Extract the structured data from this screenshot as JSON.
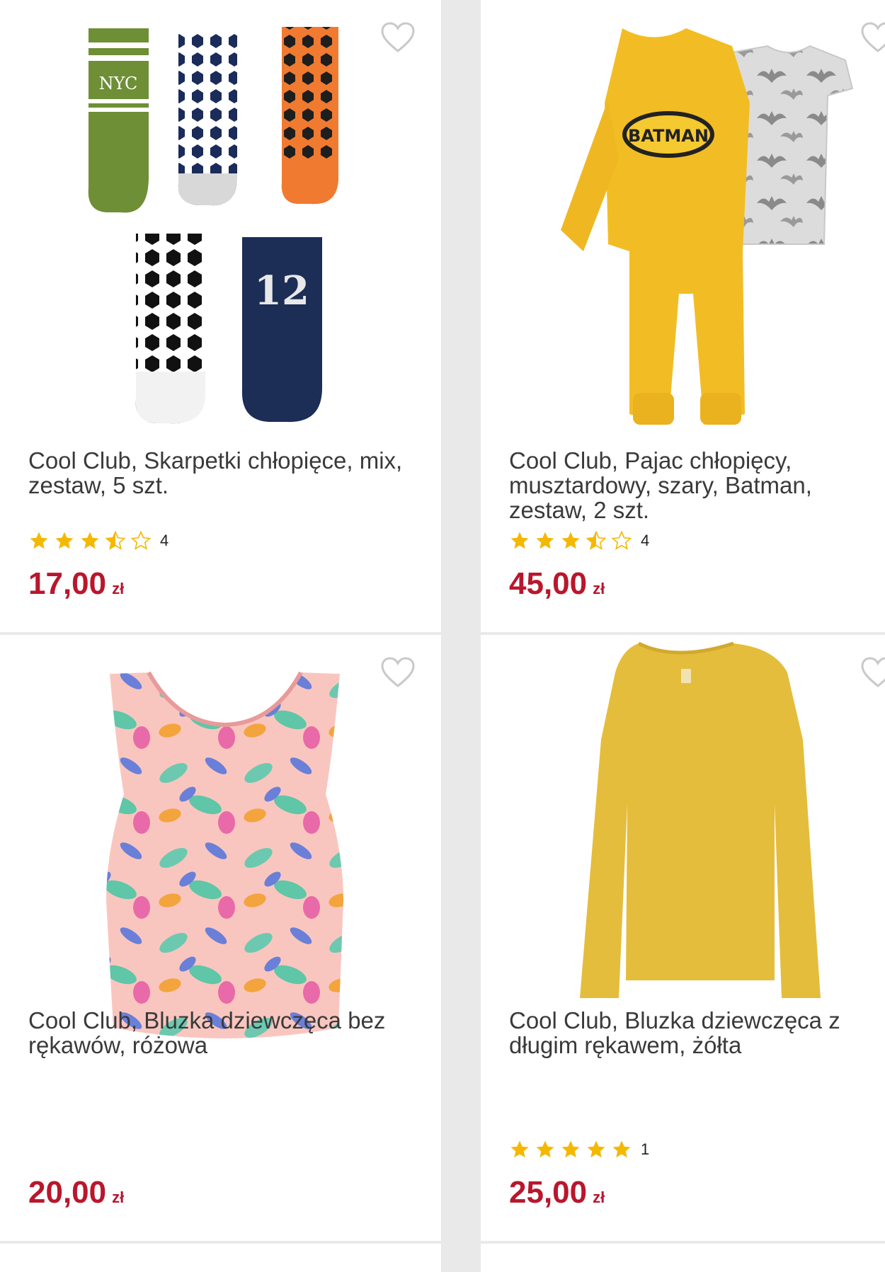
{
  "products": [
    {
      "title": "Cool Club, Skarpetki chłopięce, mix, zestaw, 5 szt.",
      "rating": 3.5,
      "rating_count": "4",
      "price": "17,00",
      "currency": "zł",
      "sock_texts": [
        "NYC",
        "12"
      ]
    },
    {
      "title": "Cool Club, Pajac chłopięcy, musztardowy, szary, Batman, zestaw, 2 szt.",
      "rating": 3.5,
      "rating_count": "4",
      "price": "45,00",
      "currency": "zł",
      "print_text": "BATMAN"
    },
    {
      "title": "Cool Club, Bluzka dziewczęca bez rękawów, różowa",
      "price": "20,00",
      "currency": "zł"
    },
    {
      "title": "Cool Club, Bluzka dziewczęca z długim rękawem, żółta",
      "rating": 5,
      "rating_count": "1",
      "price": "25,00",
      "currency": "zł"
    }
  ],
  "icons": {
    "favorite": "heart-outline-icon",
    "star_full": "star-filled-icon",
    "star_half": "star-half-icon",
    "star_empty": "star-empty-icon"
  },
  "colors": {
    "price": "#b8172d",
    "star": "#f5b800",
    "page_background": "#e9e9e9",
    "card_background": "#ffffff"
  }
}
